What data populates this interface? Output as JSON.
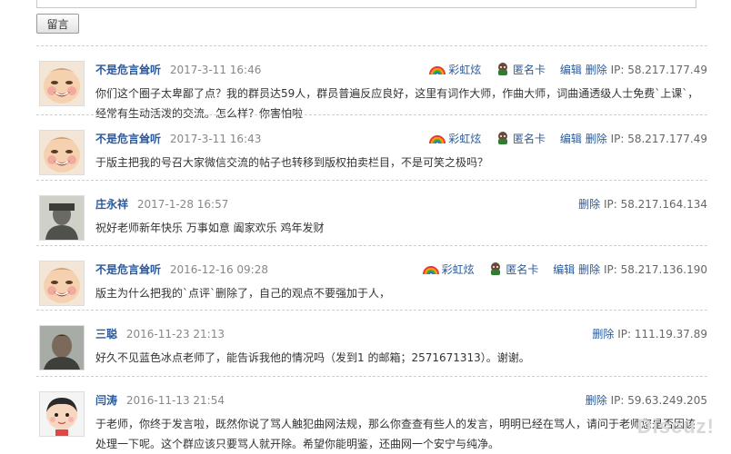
{
  "form": {
    "submit_label": "留言"
  },
  "comments": [
    {
      "user": "不是危言耸听",
      "time": "2017-3-11 16:46",
      "magic1": "彩虹炫",
      "magic2": "匿名卡",
      "edit": "编辑",
      "del": "删除",
      "ip": "IP: 58.217.177.49",
      "text": "你们这个圈子太卑鄙了点？我的群员达59人，群员普遍反应良好，这里有词作大师，作曲大师，词曲通透级人士免费`上课`，经常有生动活泼的交流。怎么样？你害怕啦"
    },
    {
      "user": "不是危言耸听",
      "time": "2017-3-11 16:43",
      "magic1": "彩虹炫",
      "magic2": "匿名卡",
      "edit": "编辑",
      "del": "删除",
      "ip": "IP: 58.217.177.49",
      "text": "于版主把我的号召大家微信交流的帖子也转移到版权拍卖栏目，不是可笑之极吗？"
    },
    {
      "user": "庄永祥",
      "time": "2017-1-28 16:57",
      "del": "删除",
      "ip": "IP: 58.217.164.134",
      "text": "祝好老师新年快乐 万事如意 阖家欢乐  鸡年发财"
    },
    {
      "user": "不是危言耸听",
      "time": "2016-12-16 09:28",
      "magic1": "彩虹炫",
      "magic2": "匿名卡",
      "edit": "编辑",
      "del": "删除",
      "ip": "IP: 58.217.136.190",
      "text": "版主为什么把我的`点评`删除了，自己的观点不要强加于人，"
    },
    {
      "user": "三聪",
      "time": "2016-11-23 21:13",
      "del": "删除",
      "ip": "IP: 111.19.37.89",
      "text": "好久不见蓝色冰点老师了，能告诉我他的情况吗（发到1 的邮箱；2571671313）。谢谢。"
    },
    {
      "user": "闫涛",
      "time": "2016-11-13 21:54",
      "del": "删除",
      "ip": "IP: 59.63.249.205",
      "text": "于老师，你终于发言啦，既然你说了骂人触犯曲网法规，那么你查查有些人的发言，明明已经在骂人，请问于老师您是否因该处理一下呢。这个群应该只要骂人就开除。希望你能明鉴，还曲网一个安宁与纯净。"
    }
  ],
  "watermark": "Discuz!"
}
